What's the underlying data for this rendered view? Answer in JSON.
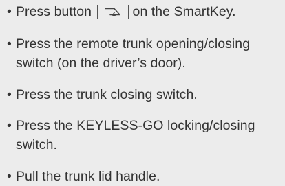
{
  "items": [
    {
      "bullet": "•",
      "before": "Press button",
      "icon": "trunk-close-icon",
      "after": "on the SmartKey."
    },
    {
      "bullet": "•",
      "text": "Press the remote trunk opening/closing switch (on the driver’s door)."
    },
    {
      "bullet": "•",
      "text": "Press the trunk closing switch."
    },
    {
      "bullet": "•",
      "text": "Press the KEYLESS-GO locking/closing switch."
    },
    {
      "bullet": "•",
      "text": "Pull the trunk lid handle."
    }
  ]
}
